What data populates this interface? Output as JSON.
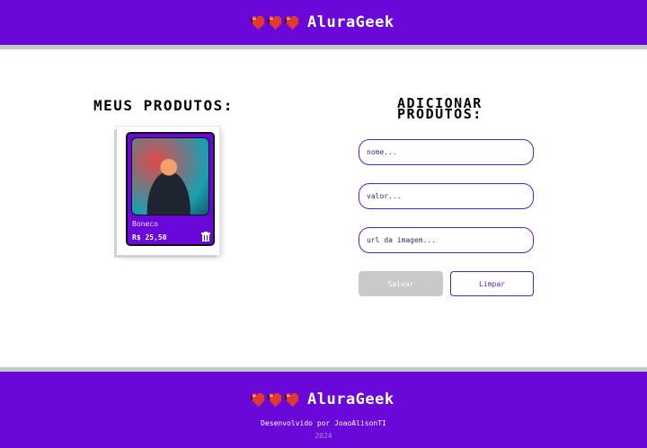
{
  "header": {
    "logo_text": "AluraGeek",
    "icons": [
      "heart-icon",
      "heart-icon",
      "heart-icon"
    ]
  },
  "products": {
    "title": "MEUS PRODUTOS:",
    "items": [
      {
        "name": "Boneco",
        "price": "R$ 25,50",
        "delete_icon": "trash-icon"
      }
    ]
  },
  "form": {
    "title": "ADICIONAR PRODUTOS:",
    "name_placeholder": "nome...",
    "price_placeholder": "valor...",
    "url_placeholder": "url da imagem...",
    "save_label": "Salvar",
    "clear_label": "Limpar"
  },
  "footer": {
    "logo_text": "AluraGeek",
    "credit": "Desenvolvido por JoaoAlisonTI",
    "year": "2024"
  },
  "colors": {
    "brand_purple": "#6a08da",
    "border_gray": "#c7c7c7",
    "heart_red": "#e03a2e"
  }
}
